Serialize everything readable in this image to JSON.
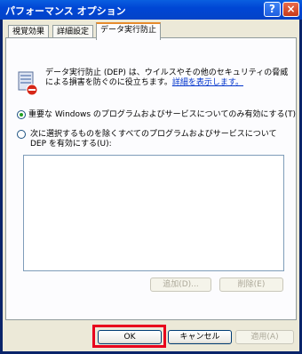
{
  "window": {
    "title": "パフォーマンス オプション"
  },
  "titlebar": {
    "help_glyph": "?",
    "close_glyph": "×"
  },
  "tabs": [
    {
      "label": "視覚効果",
      "active": false
    },
    {
      "label": "詳細設定",
      "active": false
    },
    {
      "label": "データ実行防止",
      "active": true
    }
  ],
  "dep": {
    "description": "データ実行防止 (DEP) は、ウイルスやその他のセキュリティの脅威による損害を防ぐのに役立ちます。",
    "link_text": "詳細を表示します。",
    "option1_label": "重要な Windows のプログラムおよびサービスについてのみ有効にする(T)",
    "option1_selected": true,
    "option2_label": "次に選択するものを除くすべてのプログラムおよびサービスについて DEP を有効にする(U):",
    "option2_selected": false,
    "add_button": "追加(D)...",
    "remove_button": "削除(E)"
  },
  "footer": {
    "ok_button": "OK",
    "cancel_button": "キャンセル",
    "apply_button": "適用(A)"
  },
  "icons": {
    "dep_icon": "shield-icon",
    "help_icon": "help-icon",
    "close_icon": "close-icon"
  },
  "colors": {
    "highlight": "#e8001c",
    "titlebar": "#0046d5",
    "link": "#0033cc"
  }
}
